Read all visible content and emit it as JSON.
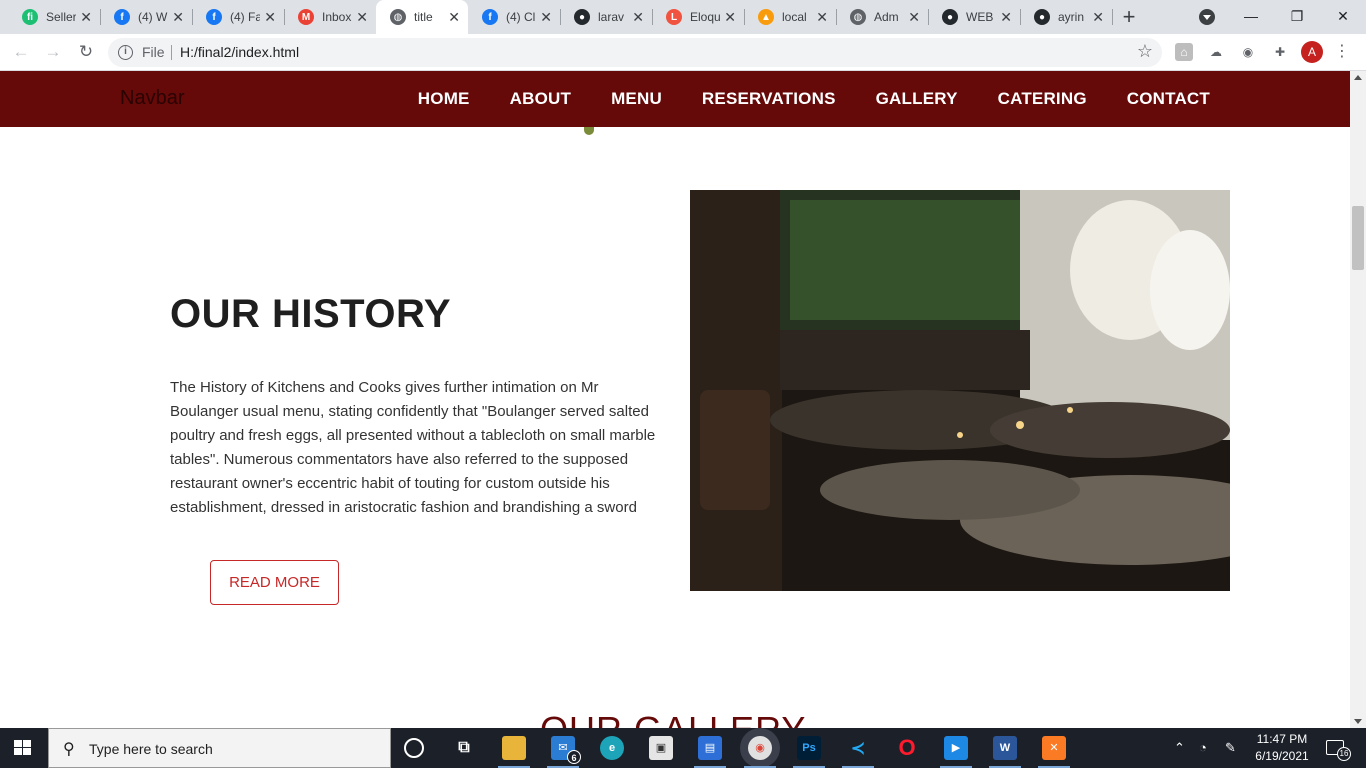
{
  "browser": {
    "tabs": [
      {
        "title": "Seller",
        "icon": "fiverr-icon",
        "color": "#1dbf73",
        "glyph": "fi"
      },
      {
        "title": "(4) W",
        "icon": "facebook-icon",
        "color": "#1877f2",
        "glyph": "f"
      },
      {
        "title": "(4) Fa",
        "icon": "facebook-icon",
        "color": "#1877f2",
        "glyph": "f"
      },
      {
        "title": "Inbox",
        "icon": "gmail-icon",
        "color": "#ea4335",
        "glyph": "M"
      },
      {
        "title": "title",
        "icon": "globe-icon",
        "color": "#5f6368",
        "glyph": "◍",
        "active": true
      },
      {
        "title": "(4) Cl",
        "icon": "facebook-icon",
        "color": "#1877f2",
        "glyph": "f"
      },
      {
        "title": "larav",
        "icon": "github-icon",
        "color": "#24292e",
        "glyph": "●"
      },
      {
        "title": "Eloqu",
        "icon": "laravel-icon",
        "color": "#f05340",
        "glyph": "L"
      },
      {
        "title": "local",
        "icon": "phpmyadmin-icon",
        "color": "#f89c0e",
        "glyph": "▲"
      },
      {
        "title": "Adm",
        "icon": "globe-icon",
        "color": "#5f6368",
        "glyph": "◍"
      },
      {
        "title": "WEB",
        "icon": "github-icon",
        "color": "#24292e",
        "glyph": "●"
      },
      {
        "title": "ayrin",
        "icon": "github-icon",
        "color": "#24292e",
        "glyph": "●"
      }
    ],
    "new_tab_label": "+",
    "address": {
      "scheme_label": "File",
      "url": "H:/final2/index.html"
    },
    "profile_initial": "A"
  },
  "site": {
    "brand": "Navbar",
    "nav": [
      "HOME",
      "ABOUT",
      "MENU",
      "RESERVATIONS",
      "GALLERY",
      "CATERING",
      "CONTACT"
    ],
    "history": {
      "title": "OUR HISTORY",
      "body": "The History of Kitchens and Cooks gives further intimation on Mr Boulanger usual menu, stating confidently that \"Boulanger served salted poultry and fresh eggs, all presented without a tablecloth on small marble tables\". Numerous commentators have also referred to the supposed restaurant owner's eccentric habit of touting for custom outside his establishment, dressed in aristocratic fashion and brandishing a sword",
      "button": "READ MORE"
    },
    "gallery_title": "OUR GALLERY",
    "colors": {
      "nav_bg": "#650909",
      "accent_red": "#c62828",
      "gallery_title": "#650909"
    }
  },
  "taskbar": {
    "search_placeholder": "Type here to search",
    "mail_badge": "6",
    "time": "11:47 PM",
    "date": "6/19/2021",
    "notifications": "16"
  }
}
